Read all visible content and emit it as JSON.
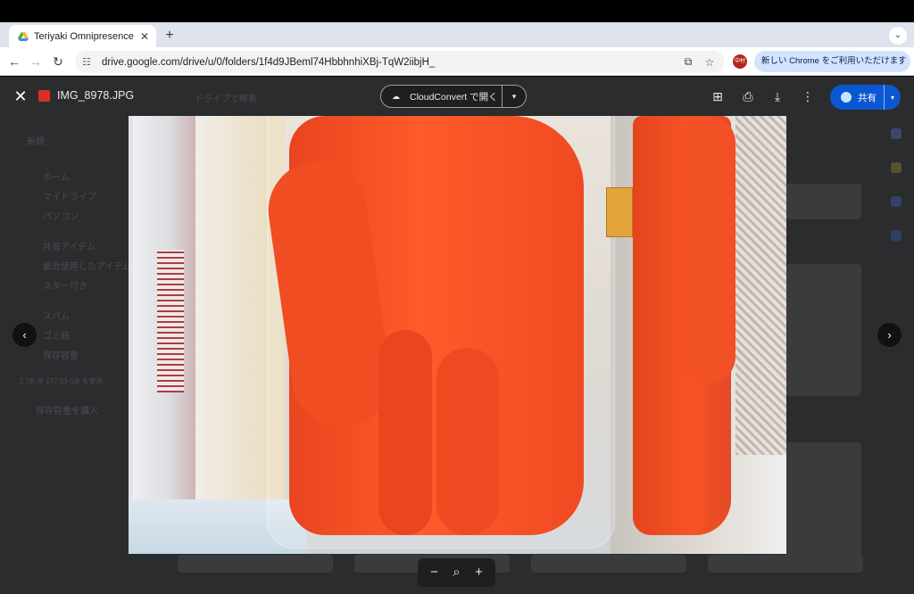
{
  "browser": {
    "tab_title": "Teriyaki Omnipresence - Goo",
    "tab_close": "✕",
    "new_tab": "+",
    "tab_search": "⌄",
    "url": "drive.google.com/drive/u/0/folders/1f4d9JBeml74HbbhnhiXBj-TqW2iibjH_",
    "profile_text": "中村",
    "notice": "新しい Chrome をご利用いただけます",
    "notice_menu": "⋮"
  },
  "drive_bg": {
    "search_placeholder": "ドライブで検索",
    "new_label": "新規",
    "nav": [
      "ホーム",
      "マイドライブ",
      "パソコン",
      "共有アイテム",
      "最近使用したアイテム",
      "スター付き",
      "スパム",
      "ゴミ箱",
      "保存容量"
    ],
    "storage": "2 TB 中 177.93 GB を使用",
    "storage_button": "保存容量を購入"
  },
  "viewer": {
    "close": "✕",
    "file_name": "IMG_8978.JPG",
    "open_with_label": "CloudConvert で開く",
    "open_with_caret": "▾",
    "add_shortcut": "⊞",
    "print": "⎙",
    "download": "⤓",
    "more": "⋮",
    "share_label": "共有",
    "share_caret": "▾",
    "prev": "‹",
    "next": "›"
  },
  "zoom": {
    "zoom_out": "−",
    "zoom_reset": "⌕",
    "zoom_in": "+"
  }
}
